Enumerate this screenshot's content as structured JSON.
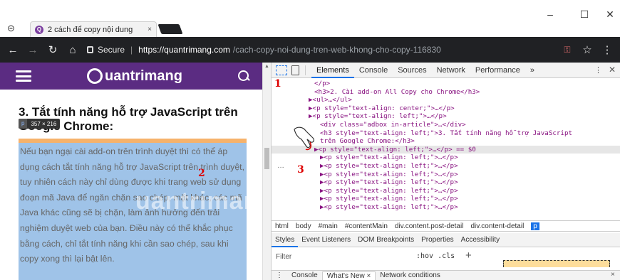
{
  "window": {
    "minimize": "–",
    "maximize": "☐",
    "close": "✕"
  },
  "tab": {
    "title": "2 cách để copy nội dung",
    "close": "×"
  },
  "address": {
    "secure_label": "Secure",
    "host": "https://quantrimang.com",
    "path": "/cach-copy-noi-dung-tren-web-khong-cho-copy-116830"
  },
  "site": {
    "logo_text": "uantrimang",
    "heading": "3. Tắt tính năng hỗ trợ JavaScript trên Google Chrome:",
    "dim_tag": "p",
    "dim_size": "357 × 216",
    "paragraph": "Nếu bạn ngại cài add-on trên trình duyệt thì có thể áp dụng cách tắt tính năng hỗ trợ JavaScript trên trình duyệt, tuy nhiên cách này chỉ dùng được khi trang web sử dụng đoạn mã Java để ngăn chặn sao chép, mặt khác, các mã Java khác cũng sẽ bị chặn, làm ảnh hưởng đến trải nghiệm duyệt web của bạn. Điều này có thể khắc phục bằng cách, chỉ tắt tính năng khi cần sao chép, sau khi copy xong thì lại bật lên.",
    "watermark": "uantrimang"
  },
  "annotations": {
    "one": "1",
    "two": "2",
    "three": "3"
  },
  "devtools": {
    "tabs": [
      "Elements",
      "Console",
      "Sources",
      "Network",
      "Performance"
    ],
    "more": "»",
    "menu": "⋮",
    "close": "✕",
    "tree": [
      {
        "text": "</p>"
      },
      {
        "text": "<h3>2. Cài add-on All Copy cho Chrome</h3>"
      },
      {
        "text": "▶<ul>…</ul>"
      },
      {
        "text": "▶<p style=\"text-align: center;\">…</p>"
      },
      {
        "text": "▶<p style=\"text-align: left;\">…</p>"
      },
      {
        "text": "<div class=\"adbox in-article\">…</div>"
      },
      {
        "text": "<h3 style=\"text-align: left;\">3. Tắt tính năng hỗ trợ JavaScript"
      },
      {
        "text": "trên Google Chrome:</h3>"
      },
      {
        "text": "▶<p style=\"text-align: left;\">…</p> == $0",
        "selected": true
      },
      {
        "text": "▶<p style=\"text-align: left;\">…</p>"
      },
      {
        "text": "▶<p style=\"text-align: left;\">…</p>"
      },
      {
        "text": "▶<p style=\"text-align: left;\">…</p>"
      },
      {
        "text": "▶<p style=\"text-align: left;\">…</p>"
      },
      {
        "text": "▶<p style=\"text-align: left;\">…</p>"
      },
      {
        "text": "▶<p style=\"text-align: left;\">…</p>"
      },
      {
        "text": "▶<p style=\"text-align: left;\">…</p>"
      }
    ],
    "dots": "…",
    "breadcrumbs": [
      "html",
      "body",
      "#main",
      "#contentMain",
      "div.content.post-detail",
      "div.content-detail",
      "p"
    ],
    "subtabs": [
      "Styles",
      "Event Listeners",
      "DOM Breakpoints",
      "Properties",
      "Accessibility"
    ],
    "filter_placeholder": "Filter",
    "hov_cls": ":hov .cls",
    "plus": "+",
    "drawer_menu": "⋮",
    "drawer_tabs": [
      "Console",
      "What's New ×",
      "Network conditions"
    ],
    "drawer_close": "×"
  },
  "colors": {
    "brand": "#5b2c82",
    "selection": "#9fc3e8",
    "accent": "#1a73e8"
  }
}
